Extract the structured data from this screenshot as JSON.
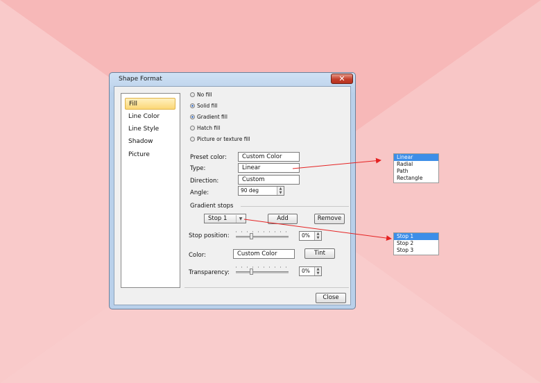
{
  "dialog": {
    "title": "Shape Format",
    "close_glyph": "✕"
  },
  "nav": {
    "items": [
      "Fill",
      "Line Color",
      "Line Style",
      "Shadow",
      "Picture"
    ],
    "selected": "Fill"
  },
  "fill_options": [
    {
      "label": "No fill",
      "checked": false
    },
    {
      "label": "Solid fill",
      "checked": true
    },
    {
      "label": "Gradient fill",
      "checked": true
    },
    {
      "label": "Hatch fill",
      "checked": false
    },
    {
      "label": "Picture or texture fill",
      "checked": false
    }
  ],
  "form": {
    "preset_label": "Preset color:",
    "preset_value": "Custom Color",
    "type_label": "Type:",
    "type_value": "Linear",
    "direction_label": "Direction:",
    "direction_value": "Custom",
    "angle_label": "Angle:",
    "angle_value": "90 deg",
    "gradient_stops_label": "Gradient stops",
    "stop_value": "Stop 1",
    "add_label": "Add",
    "remove_label": "Remove",
    "stop_position_label": "Stop position:",
    "stop_position_value": "0%",
    "color_label": "Color:",
    "color_value": "Custom Color",
    "tint_label": "Tint",
    "transparency_label": "Transparency:",
    "transparency_value": "0%",
    "close_label": "Close"
  },
  "type_popup": {
    "options": [
      "Linear",
      "Radial",
      "Path",
      "Rectangle"
    ],
    "highlighted": "Linear"
  },
  "stop_popup": {
    "options": [
      "Stop 1",
      "Stop 2",
      "Stop 3"
    ],
    "highlighted": "Stop 1"
  },
  "colors": {
    "background": "#f6c4c4",
    "highlight": "#3d8ee8",
    "annotation_arrow": "#e52222",
    "selected_nav": "#fbd777"
  }
}
